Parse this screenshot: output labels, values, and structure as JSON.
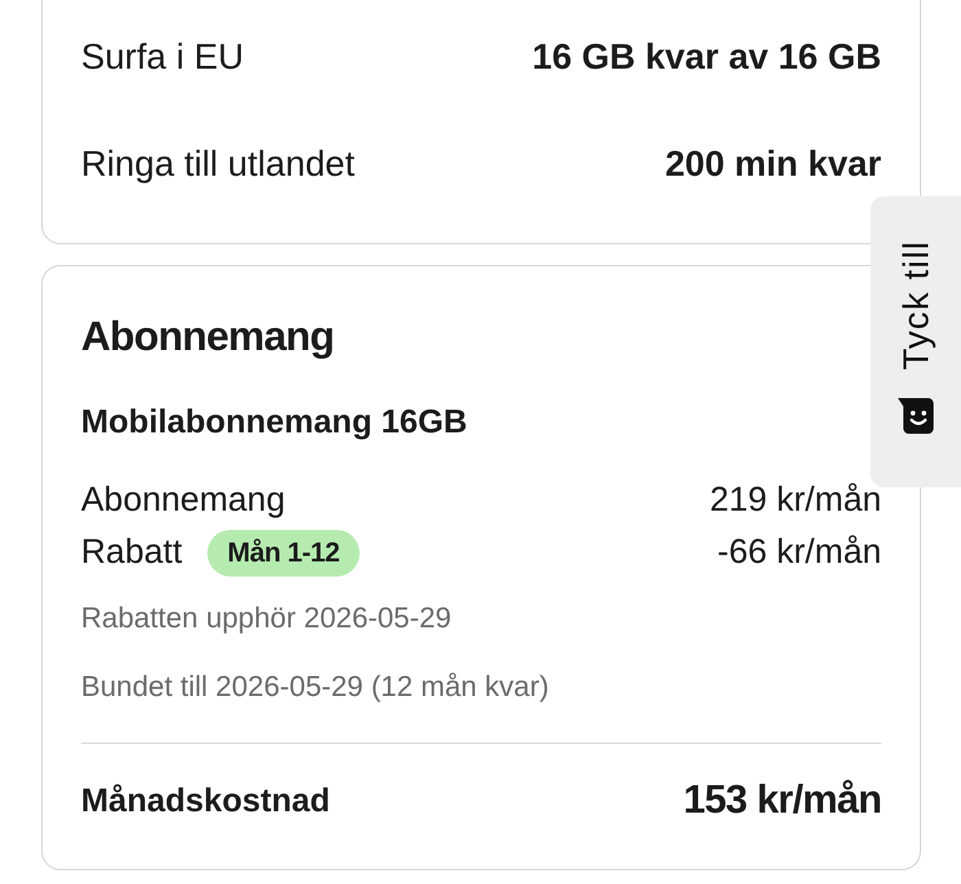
{
  "usage_card": {
    "rows": [
      {
        "label": "Surfa i EU",
        "value": "16 GB kvar av 16 GB"
      },
      {
        "label": "Ringa till utlandet",
        "value": "200 min kvar"
      }
    ]
  },
  "subscription_card": {
    "title": "Abonnemang",
    "plan_name": "Mobilabonnemang 16GB",
    "price_rows": [
      {
        "label": "Abonnemang",
        "value": "219 kr/mån"
      },
      {
        "label": "Rabatt",
        "badge": "Mån 1-12",
        "value": "-66 kr/mån"
      }
    ],
    "notes": [
      "Rabatten upphör 2026-05-29",
      "Bundet till 2026-05-29 (12 mån kvar)"
    ],
    "total": {
      "label": "Månadskostnad",
      "value": "153 kr/mån"
    }
  },
  "feedback_tab": {
    "label": "Tyck till"
  }
}
